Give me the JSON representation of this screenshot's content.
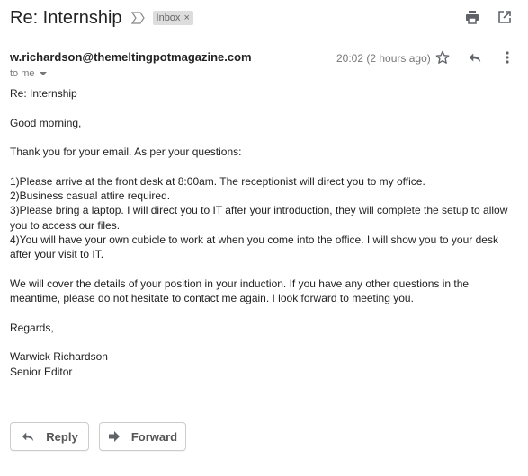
{
  "email": {
    "subject": "Re: Internship",
    "label": "Inbox",
    "label_remove": "×",
    "sender": "w.richardson@themeltingpotmagazine.com",
    "recipient": "to me",
    "timestamp": "20:02 (2 hours ago)",
    "body": {
      "lines": [
        "Re: Internship",
        "",
        "Good morning,",
        "",
        "Thank you for your email. As per your questions:",
        "",
        "1)Please arrive at the front desk at 8:00am. The receptionist will direct you to my office.",
        "2)Business casual attire required.",
        "3)Please bring a laptop. I will direct you to IT after your introduction, they will complete the setup to allow you to access our files.",
        "4)You will have your own cubicle to work at when you come into the office. I will show you to your desk after your visit to IT.",
        "",
        "We will cover the details of your position in your induction. If you have any other questions in the meantime, please do not hesitate to contact me again. I look forward to meeting you.",
        "",
        "Regards,",
        "",
        "Warwick Richardson",
        "Senior Editor"
      ]
    }
  },
  "actions": {
    "reply_label": "Reply",
    "forward_label": "Forward"
  },
  "icons": {
    "importance": "importance-marker-icon",
    "print": "print-icon",
    "open_new_window": "open-in-new-window-icon",
    "star": "star-icon",
    "reply": "reply-icon",
    "more": "more-vert-icon",
    "dropdown": "caret-down-icon",
    "forward": "forward-icon"
  },
  "colors": {
    "text": "#222222",
    "muted": "#777777",
    "chip_bg": "#dddddd",
    "icon": "#5f6368"
  }
}
